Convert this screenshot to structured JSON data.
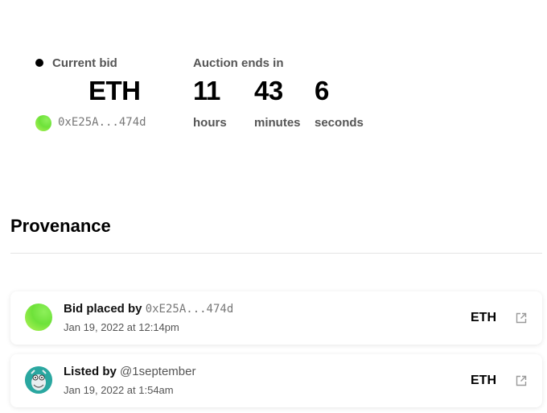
{
  "bid": {
    "label": "Current bid",
    "currency": "ETH",
    "bidder": "0xE25A...474d"
  },
  "auction": {
    "label": "Auction ends in",
    "hours_value": "11",
    "hours_unit": "hours",
    "minutes_value": "43",
    "minutes_unit": "minutes",
    "seconds_value": "6",
    "seconds_unit": "seconds"
  },
  "provenance": {
    "title": "Provenance",
    "items": [
      {
        "prefix": "Bid placed by",
        "actor": "0xE25A...474d",
        "date": "Jan 19, 2022 at 12:14pm",
        "amount": "ETH",
        "avatar": "gradient-avatar",
        "link_icon": "external-link-icon"
      },
      {
        "prefix": "Listed by",
        "actor": "@1september",
        "date": "Jan 19, 2022 at 1:54am",
        "amount": "ETH",
        "avatar": "artist-avatar",
        "link_icon": "external-link-icon"
      }
    ]
  },
  "colors": {
    "accent_green": "#6ee23a",
    "artist_teal": "#2aa7a0"
  }
}
